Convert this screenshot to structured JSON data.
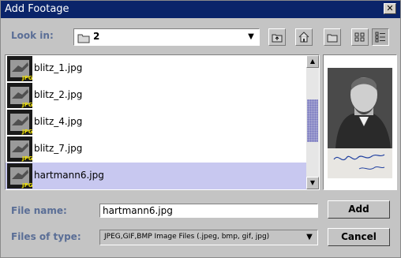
{
  "window": {
    "title": "Add Footage",
    "close_glyph": "✕"
  },
  "look_in": {
    "label": "Look in:",
    "value": "2",
    "arrow": "▼"
  },
  "toolbar": [
    "up-one-level-icon",
    "home-icon",
    "new-folder-icon",
    "list-view-icon",
    "details-view-icon"
  ],
  "files": [
    {
      "name": "blitz_1.jpg",
      "badge": "JPG",
      "selected": false
    },
    {
      "name": "blitz_2.jpg",
      "badge": "JPG",
      "selected": false
    },
    {
      "name": "blitz_4.jpg",
      "badge": "JPG",
      "selected": false
    },
    {
      "name": "blitz_7.jpg",
      "badge": "JPG",
      "selected": false
    },
    {
      "name": "hartmann6.jpg",
      "badge": "JPG",
      "selected": true
    }
  ],
  "scrollbar": {
    "up": "▲",
    "down": "▼"
  },
  "file_name": {
    "label": "File name:",
    "value": "hartmann6.jpg"
  },
  "file_type": {
    "label": "Files of type:",
    "value": "JPEG,GIF,BMP Image Files (.jpeg, bmp, gif, jpg)",
    "arrow": "▼"
  },
  "buttons": {
    "add": "Add",
    "cancel": "Cancel"
  },
  "colors": {
    "title_bar": "#0a246a",
    "label_text": "#5a6e96",
    "selection": "#c8c8f0"
  }
}
